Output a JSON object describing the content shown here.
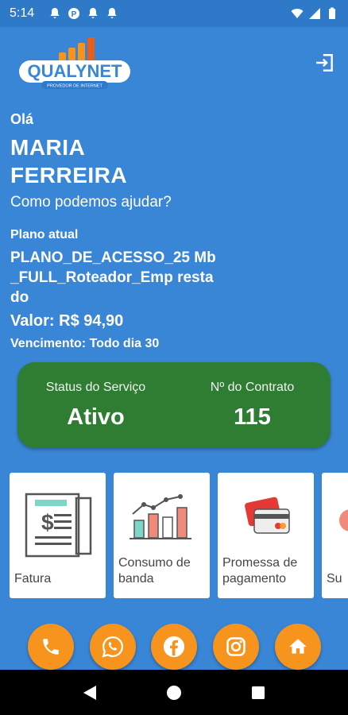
{
  "status_bar": {
    "time": "5:14",
    "icons": [
      "notification-icon",
      "notification-icon",
      "app-icon",
      "notification-icon",
      "notification-icon",
      "wifi-icon",
      "signal-icon",
      "battery-icon"
    ]
  },
  "header": {
    "logo_text": "QUALYNET",
    "logo_tagline": "PROVEDOR DE INTERNET",
    "logout_icon": "logout-icon"
  },
  "greeting": {
    "hello": "Olá",
    "name_line1": "MARIA",
    "name_line2": "FERREIRA",
    "help": "Como podemos ajudar?"
  },
  "plan": {
    "label": "Plano atual",
    "name": "PLANO_DE_ACESSO_25 Mb_FULL_Roteador_Emp restado",
    "value": "Valor: R$ 94,90",
    "due": "Vencimento: Todo dia 30"
  },
  "service_card": {
    "status_label": "Status do Serviço",
    "status_value": "Ativo",
    "contract_label": "Nº do Contrato",
    "contract_value": "115",
    "color": "#2e7d32"
  },
  "tiles": [
    {
      "label": "Fatura",
      "icon": "invoice-icon"
    },
    {
      "label": "Consumo de banda",
      "icon": "bandwidth-chart-icon"
    },
    {
      "label": "Promessa de pagamento",
      "icon": "credit-card-icon"
    },
    {
      "label": "Su",
      "icon": "support-icon"
    }
  ],
  "fabs": [
    {
      "name": "phone-button",
      "icon": "phone-icon"
    },
    {
      "name": "whatsapp-button",
      "icon": "whatsapp-icon"
    },
    {
      "name": "facebook-button",
      "icon": "facebook-icon"
    },
    {
      "name": "instagram-button",
      "icon": "instagram-icon"
    },
    {
      "name": "home-button",
      "icon": "home-icon"
    }
  ],
  "colors": {
    "background": "#3a86d6",
    "accent": "#f7941d",
    "card_green": "#2e7d32"
  }
}
